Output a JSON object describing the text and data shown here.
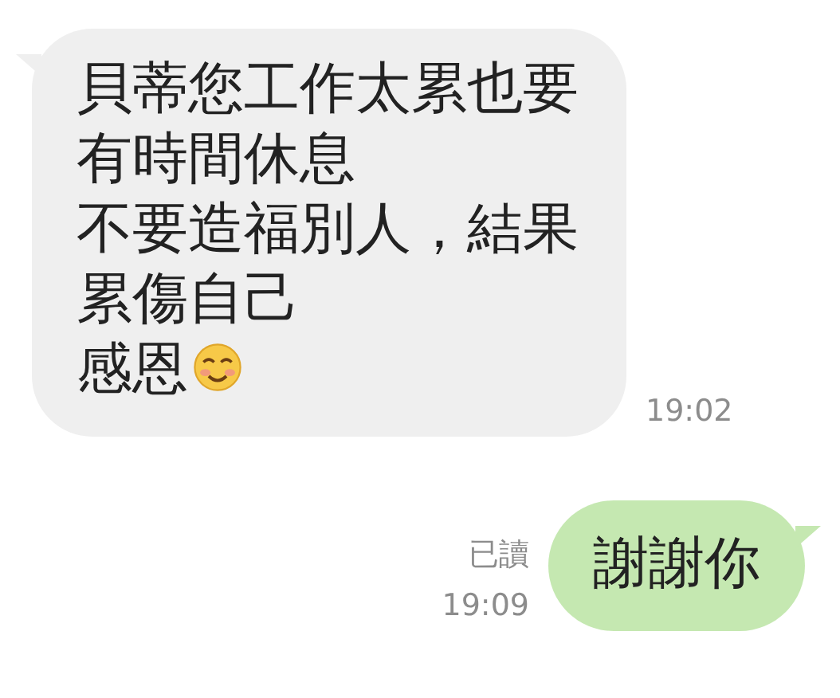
{
  "messages": [
    {
      "kind": "incoming",
      "lines": [
        "貝蒂您工作太累也要",
        "有時間休息",
        "不要造福別人，結果",
        "累傷自己",
        "感恩"
      ],
      "ends_with_smiley": true,
      "time": "19:02"
    },
    {
      "kind": "outgoing",
      "lines": [
        "謝謝你"
      ],
      "read_label": "已讀",
      "time": "19:09"
    }
  ]
}
